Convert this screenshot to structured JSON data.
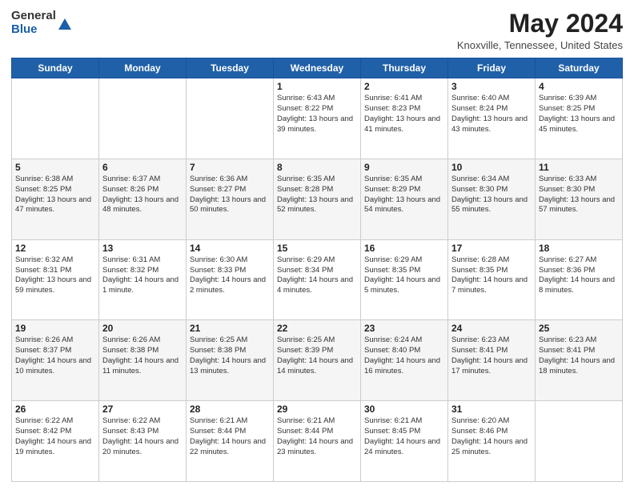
{
  "header": {
    "logo_general": "General",
    "logo_blue": "Blue",
    "title": "May 2024",
    "location": "Knoxville, Tennessee, United States"
  },
  "columns": [
    "Sunday",
    "Monday",
    "Tuesday",
    "Wednesday",
    "Thursday",
    "Friday",
    "Saturday"
  ],
  "weeks": [
    [
      {
        "day": "",
        "sunrise": "",
        "sunset": "",
        "daylight": ""
      },
      {
        "day": "",
        "sunrise": "",
        "sunset": "",
        "daylight": ""
      },
      {
        "day": "",
        "sunrise": "",
        "sunset": "",
        "daylight": ""
      },
      {
        "day": "1",
        "sunrise": "Sunrise: 6:43 AM",
        "sunset": "Sunset: 8:22 PM",
        "daylight": "Daylight: 13 hours and 39 minutes."
      },
      {
        "day": "2",
        "sunrise": "Sunrise: 6:41 AM",
        "sunset": "Sunset: 8:23 PM",
        "daylight": "Daylight: 13 hours and 41 minutes."
      },
      {
        "day": "3",
        "sunrise": "Sunrise: 6:40 AM",
        "sunset": "Sunset: 8:24 PM",
        "daylight": "Daylight: 13 hours and 43 minutes."
      },
      {
        "day": "4",
        "sunrise": "Sunrise: 6:39 AM",
        "sunset": "Sunset: 8:25 PM",
        "daylight": "Daylight: 13 hours and 45 minutes."
      }
    ],
    [
      {
        "day": "5",
        "sunrise": "Sunrise: 6:38 AM",
        "sunset": "Sunset: 8:25 PM",
        "daylight": "Daylight: 13 hours and 47 minutes."
      },
      {
        "day": "6",
        "sunrise": "Sunrise: 6:37 AM",
        "sunset": "Sunset: 8:26 PM",
        "daylight": "Daylight: 13 hours and 48 minutes."
      },
      {
        "day": "7",
        "sunrise": "Sunrise: 6:36 AM",
        "sunset": "Sunset: 8:27 PM",
        "daylight": "Daylight: 13 hours and 50 minutes."
      },
      {
        "day": "8",
        "sunrise": "Sunrise: 6:35 AM",
        "sunset": "Sunset: 8:28 PM",
        "daylight": "Daylight: 13 hours and 52 minutes."
      },
      {
        "day": "9",
        "sunrise": "Sunrise: 6:35 AM",
        "sunset": "Sunset: 8:29 PM",
        "daylight": "Daylight: 13 hours and 54 minutes."
      },
      {
        "day": "10",
        "sunrise": "Sunrise: 6:34 AM",
        "sunset": "Sunset: 8:30 PM",
        "daylight": "Daylight: 13 hours and 55 minutes."
      },
      {
        "day": "11",
        "sunrise": "Sunrise: 6:33 AM",
        "sunset": "Sunset: 8:30 PM",
        "daylight": "Daylight: 13 hours and 57 minutes."
      }
    ],
    [
      {
        "day": "12",
        "sunrise": "Sunrise: 6:32 AM",
        "sunset": "Sunset: 8:31 PM",
        "daylight": "Daylight: 13 hours and 59 minutes."
      },
      {
        "day": "13",
        "sunrise": "Sunrise: 6:31 AM",
        "sunset": "Sunset: 8:32 PM",
        "daylight": "Daylight: 14 hours and 1 minute."
      },
      {
        "day": "14",
        "sunrise": "Sunrise: 6:30 AM",
        "sunset": "Sunset: 8:33 PM",
        "daylight": "Daylight: 14 hours and 2 minutes."
      },
      {
        "day": "15",
        "sunrise": "Sunrise: 6:29 AM",
        "sunset": "Sunset: 8:34 PM",
        "daylight": "Daylight: 14 hours and 4 minutes."
      },
      {
        "day": "16",
        "sunrise": "Sunrise: 6:29 AM",
        "sunset": "Sunset: 8:35 PM",
        "daylight": "Daylight: 14 hours and 5 minutes."
      },
      {
        "day": "17",
        "sunrise": "Sunrise: 6:28 AM",
        "sunset": "Sunset: 8:35 PM",
        "daylight": "Daylight: 14 hours and 7 minutes."
      },
      {
        "day": "18",
        "sunrise": "Sunrise: 6:27 AM",
        "sunset": "Sunset: 8:36 PM",
        "daylight": "Daylight: 14 hours and 8 minutes."
      }
    ],
    [
      {
        "day": "19",
        "sunrise": "Sunrise: 6:26 AM",
        "sunset": "Sunset: 8:37 PM",
        "daylight": "Daylight: 14 hours and 10 minutes."
      },
      {
        "day": "20",
        "sunrise": "Sunrise: 6:26 AM",
        "sunset": "Sunset: 8:38 PM",
        "daylight": "Daylight: 14 hours and 11 minutes."
      },
      {
        "day": "21",
        "sunrise": "Sunrise: 6:25 AM",
        "sunset": "Sunset: 8:38 PM",
        "daylight": "Daylight: 14 hours and 13 minutes."
      },
      {
        "day": "22",
        "sunrise": "Sunrise: 6:25 AM",
        "sunset": "Sunset: 8:39 PM",
        "daylight": "Daylight: 14 hours and 14 minutes."
      },
      {
        "day": "23",
        "sunrise": "Sunrise: 6:24 AM",
        "sunset": "Sunset: 8:40 PM",
        "daylight": "Daylight: 14 hours and 16 minutes."
      },
      {
        "day": "24",
        "sunrise": "Sunrise: 6:23 AM",
        "sunset": "Sunset: 8:41 PM",
        "daylight": "Daylight: 14 hours and 17 minutes."
      },
      {
        "day": "25",
        "sunrise": "Sunrise: 6:23 AM",
        "sunset": "Sunset: 8:41 PM",
        "daylight": "Daylight: 14 hours and 18 minutes."
      }
    ],
    [
      {
        "day": "26",
        "sunrise": "Sunrise: 6:22 AM",
        "sunset": "Sunset: 8:42 PM",
        "daylight": "Daylight: 14 hours and 19 minutes."
      },
      {
        "day": "27",
        "sunrise": "Sunrise: 6:22 AM",
        "sunset": "Sunset: 8:43 PM",
        "daylight": "Daylight: 14 hours and 20 minutes."
      },
      {
        "day": "28",
        "sunrise": "Sunrise: 6:21 AM",
        "sunset": "Sunset: 8:44 PM",
        "daylight": "Daylight: 14 hours and 22 minutes."
      },
      {
        "day": "29",
        "sunrise": "Sunrise: 6:21 AM",
        "sunset": "Sunset: 8:44 PM",
        "daylight": "Daylight: 14 hours and 23 minutes."
      },
      {
        "day": "30",
        "sunrise": "Sunrise: 6:21 AM",
        "sunset": "Sunset: 8:45 PM",
        "daylight": "Daylight: 14 hours and 24 minutes."
      },
      {
        "day": "31",
        "sunrise": "Sunrise: 6:20 AM",
        "sunset": "Sunset: 8:46 PM",
        "daylight": "Daylight: 14 hours and 25 minutes."
      },
      {
        "day": "",
        "sunrise": "",
        "sunset": "",
        "daylight": ""
      }
    ]
  ]
}
